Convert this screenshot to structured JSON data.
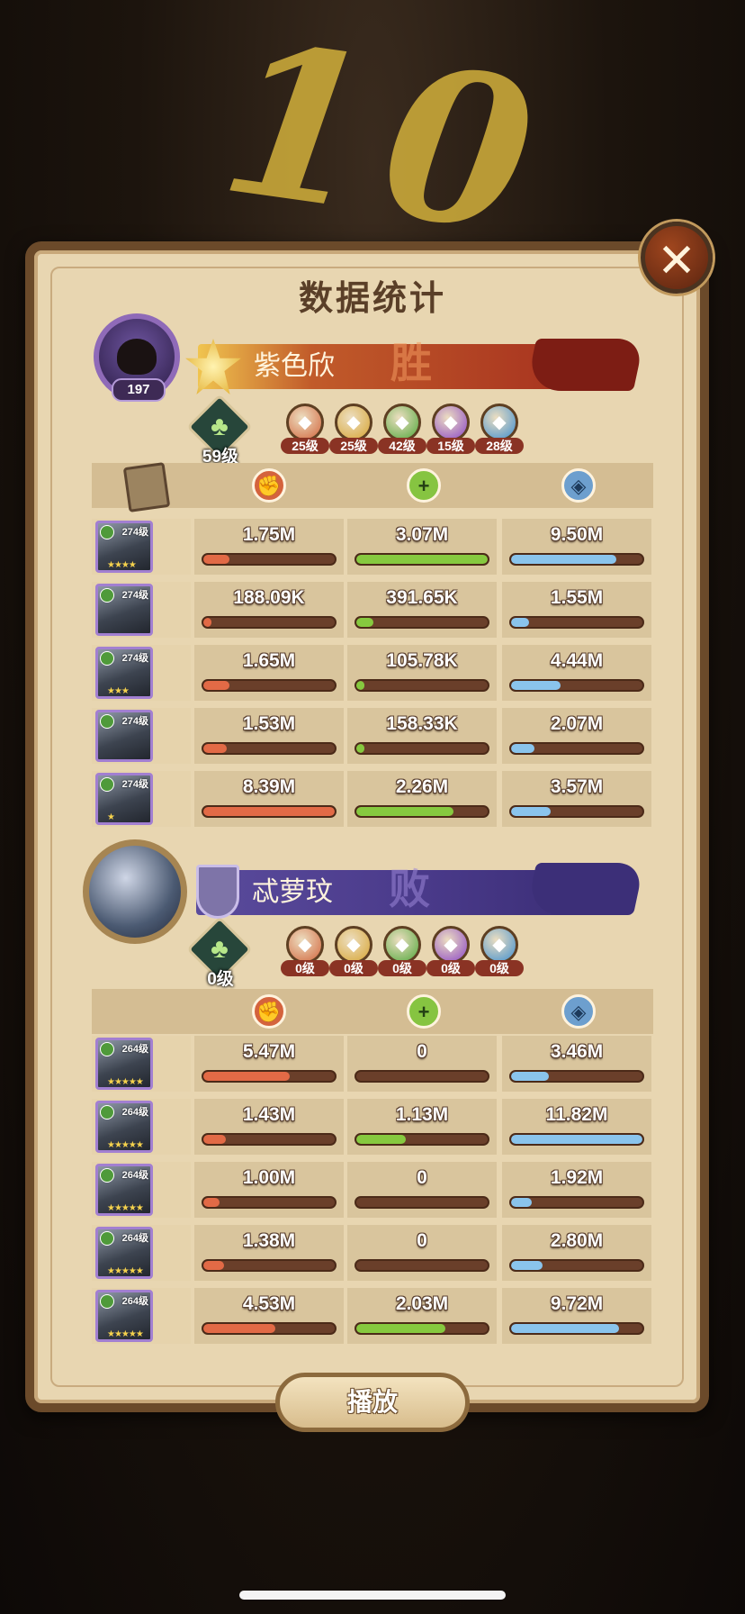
{
  "round_number": "10",
  "title": "数据统计",
  "close_icon": "close-icon",
  "colors": {
    "damage": "#e26a46",
    "heal": "#86c93f",
    "tank": "#8ac4ec",
    "winner_banner": "#a7321f",
    "loser_banner": "#4a3a8a"
  },
  "teams": [
    {
      "player_name": "紫色欣",
      "player_level": "197",
      "result": "胜",
      "tree_level": "59级",
      "factions": [
        {
          "icon": "lightbearer-icon",
          "level": "25级",
          "color": "#d2663d"
        },
        {
          "icon": "mauler-icon",
          "level": "25级",
          "color": "#d7a534"
        },
        {
          "icon": "wilder-icon",
          "level": "42级",
          "color": "#52a83c"
        },
        {
          "icon": "graveborn-icon",
          "level": "15级",
          "color": "#8c46c7"
        },
        {
          "icon": "celestial-icon",
          "level": "28级",
          "color": "#3f8fd0"
        }
      ],
      "heroes": [
        {
          "level": "274级",
          "stars": "★★★★",
          "damage": "1.75M",
          "heal": "3.07M",
          "tank": "9.50M",
          "damage_pct": 0.2,
          "heal_pct": 1.0,
          "tank_pct": 0.8
        },
        {
          "level": "274级",
          "stars": "",
          "damage": "188.09K",
          "heal": "391.65K",
          "tank": "1.55M",
          "damage_pct": 0.03,
          "heal_pct": 0.13,
          "tank_pct": 0.14
        },
        {
          "level": "274级",
          "stars": "★★★",
          "damage": "1.65M",
          "heal": "105.78K",
          "tank": "4.44M",
          "damage_pct": 0.2,
          "heal_pct": 0.04,
          "tank_pct": 0.38
        },
        {
          "level": "274级",
          "stars": "",
          "damage": "1.53M",
          "heal": "158.33K",
          "tank": "2.07M",
          "damage_pct": 0.18,
          "heal_pct": 0.05,
          "tank_pct": 0.18
        },
        {
          "level": "274级",
          "stars": "★",
          "damage": "8.39M",
          "heal": "2.26M",
          "tank": "3.57M",
          "damage_pct": 1.0,
          "heal_pct": 0.74,
          "tank_pct": 0.3
        }
      ]
    },
    {
      "player_name": "忒萝玟",
      "player_level": "",
      "result": "败",
      "tree_level": "0级",
      "factions": [
        {
          "icon": "lightbearer-icon",
          "level": "0级",
          "color": "#d2663d"
        },
        {
          "icon": "mauler-icon",
          "level": "0级",
          "color": "#d7a534"
        },
        {
          "icon": "wilder-icon",
          "level": "0级",
          "color": "#52a83c"
        },
        {
          "icon": "graveborn-icon",
          "level": "0级",
          "color": "#8c46c7"
        },
        {
          "icon": "celestial-icon",
          "level": "0级",
          "color": "#3f8fd0"
        }
      ],
      "heroes": [
        {
          "level": "264级",
          "stars": "★★★★★",
          "damage": "5.47M",
          "heal": "0",
          "tank": "3.46M",
          "damage_pct": 0.66,
          "heal_pct": 0.0,
          "tank_pct": 0.29
        },
        {
          "level": "264级",
          "stars": "★★★★★",
          "damage": "1.43M",
          "heal": "1.13M",
          "tank": "11.82M",
          "damage_pct": 0.17,
          "heal_pct": 0.38,
          "tank_pct": 1.0
        },
        {
          "level": "264级",
          "stars": "★★★★★",
          "damage": "1.00M",
          "heal": "0",
          "tank": "1.92M",
          "damage_pct": 0.12,
          "heal_pct": 0.0,
          "tank_pct": 0.16
        },
        {
          "level": "264级",
          "stars": "★★★★★",
          "damage": "1.38M",
          "heal": "0",
          "tank": "2.80M",
          "damage_pct": 0.16,
          "heal_pct": 0.0,
          "tank_pct": 0.24
        },
        {
          "level": "264级",
          "stars": "★★★★★",
          "damage": "4.53M",
          "heal": "2.03M",
          "tank": "9.72M",
          "damage_pct": 0.55,
          "heal_pct": 0.68,
          "tank_pct": 0.82
        }
      ]
    }
  ],
  "play_button": "播放"
}
